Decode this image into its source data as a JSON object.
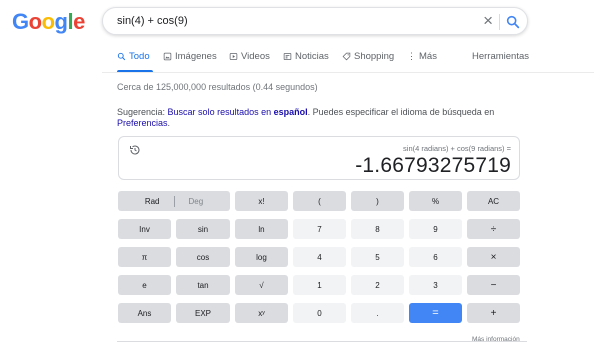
{
  "logo": {
    "letters": [
      "G",
      "o",
      "o",
      "g",
      "l",
      "e"
    ],
    "colors": [
      "#4285f4",
      "#ea4335",
      "#fbbc05",
      "#4285f4",
      "#34a853",
      "#ea4335"
    ]
  },
  "search": {
    "query": "sin(4) + cos(9)",
    "clear_glyph": "×",
    "search_icon": "search-icon"
  },
  "tabs": [
    {
      "label": "Todo",
      "icon": "search-icon",
      "active": true
    },
    {
      "label": "Imágenes",
      "icon": "image-icon",
      "active": false
    },
    {
      "label": "Videos",
      "icon": "video-icon",
      "active": false
    },
    {
      "label": "Noticias",
      "icon": "news-icon",
      "active": false
    },
    {
      "label": "Shopping",
      "icon": "tag-icon",
      "active": false
    },
    {
      "label": "Más",
      "icon": "more-vert-icon",
      "active": false
    }
  ],
  "tools_label": "Herramientas",
  "stats": "Cerca de 125,000,000 resultados (0.44 segundos)",
  "suggestion": {
    "prefix": "Sugerencia: ",
    "link1": "Buscar solo resultados en ",
    "link1_bold": "español",
    "middle": ". Puedes especificar el idioma de búsqueda en ",
    "link2": "Preferencias",
    "suffix": "."
  },
  "calculator": {
    "expression": "sin(4 radians) + cos(9 radians) =",
    "result": "-1.66793275719",
    "keys": [
      [
        "Rad | Deg",
        "x!",
        "(",
        ")",
        "%",
        "AC"
      ],
      [
        "Inv",
        "sin",
        "ln",
        "7",
        "8",
        "9",
        "÷"
      ],
      [
        "π",
        "cos",
        "log",
        "4",
        "5",
        "6",
        "×"
      ],
      [
        "e",
        "tan",
        "√",
        "1",
        "2",
        "3",
        "−"
      ],
      [
        "Ans",
        "EXP",
        "xʸ",
        "0",
        ".",
        "=",
        "+"
      ]
    ],
    "rad_label": "Rad",
    "deg_label": "Deg"
  },
  "more_info": "Más información",
  "colors": {
    "accent": "#1a73e8",
    "equals": "#4285f4",
    "link": "#1a0dab"
  }
}
